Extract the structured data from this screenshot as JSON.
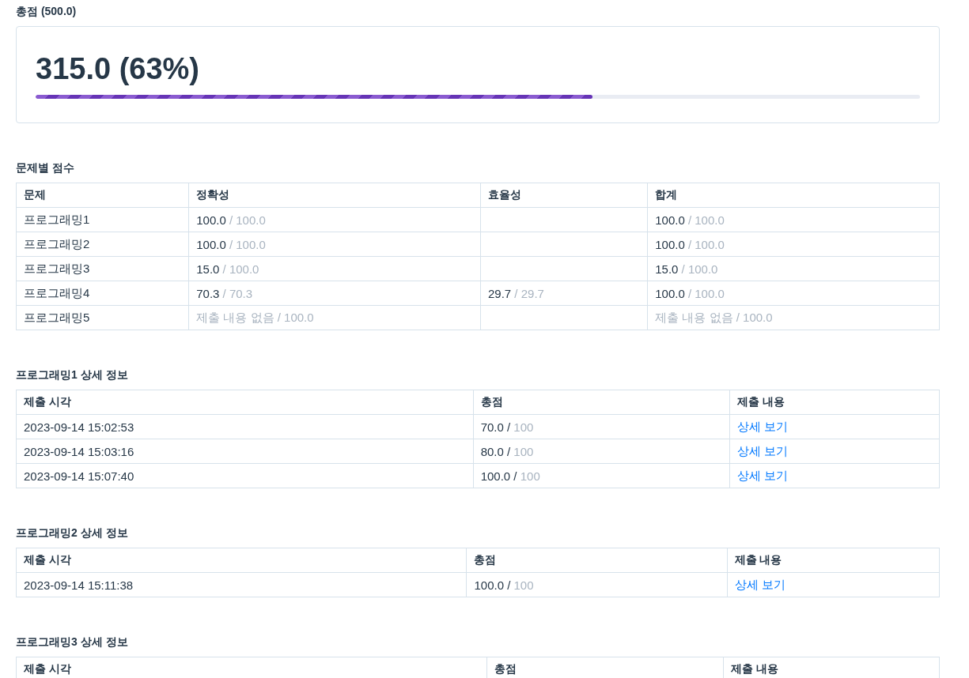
{
  "total": {
    "title": "총점 (500.0)",
    "score": "315.0 (63%)",
    "level": 0.63
  },
  "problem_scores": {
    "title": "문제별 점수",
    "columns": [
      "문제",
      "정확성",
      "효율성",
      "합계"
    ],
    "rows": [
      {
        "problem": "프로그래밍1",
        "accuracy": {
          "kind": "score",
          "value": "100.0",
          "max": "/ 100.0"
        },
        "efficiency": null,
        "total": {
          "kind": "score",
          "value": "100.0",
          "max": "/ 100.0"
        }
      },
      {
        "problem": "프로그래밍2",
        "accuracy": {
          "kind": "score",
          "value": "100.0",
          "max": "/ 100.0"
        },
        "efficiency": null,
        "total": {
          "kind": "score",
          "value": "100.0",
          "max": "/ 100.0"
        }
      },
      {
        "problem": "프로그래밍3",
        "accuracy": {
          "kind": "score",
          "value": "15.0",
          "max": "/ 100.0"
        },
        "efficiency": null,
        "total": {
          "kind": "score",
          "value": "15.0",
          "max": "/ 100.0"
        }
      },
      {
        "problem": "프로그래밍4",
        "accuracy": {
          "kind": "score",
          "value": "70.3",
          "max": "/ 70.3"
        },
        "efficiency": {
          "kind": "score",
          "value": "29.7",
          "max": "/ 29.7"
        },
        "total": {
          "kind": "score",
          "value": "100.0",
          "max": "/ 100.0"
        }
      },
      {
        "problem": "프로그래밍5",
        "accuracy": {
          "kind": "none",
          "text": "제출 내용 없음 / 100.0"
        },
        "efficiency": null,
        "total": {
          "kind": "none",
          "text": "제출 내용 없음 / 100.0"
        }
      }
    ]
  },
  "details": [
    {
      "title": "프로그래밍1 상세 정보",
      "columns": [
        "제출 시각",
        "총점",
        "제출 내용"
      ],
      "rows": [
        {
          "time": "2023-09-14 15:02:53",
          "value": "70.0 /",
          "max": "100",
          "link": "상세 보기"
        },
        {
          "time": "2023-09-14 15:03:16",
          "value": "80.0 /",
          "max": "100",
          "link": "상세 보기"
        },
        {
          "time": "2023-09-14 15:07:40",
          "value": "100.0 /",
          "max": "100",
          "link": "상세 보기"
        }
      ]
    },
    {
      "title": "프로그래밍2 상세 정보",
      "columns": [
        "제출 시각",
        "총점",
        "제출 내용"
      ],
      "rows": [
        {
          "time": "2023-09-14 15:11:38",
          "value": "100.0 /",
          "max": "100",
          "link": "상세 보기"
        }
      ]
    },
    {
      "title": "프로그래밍3 상세 정보",
      "columns": [
        "제출 시각",
        "총점",
        "제출 내용"
      ]
    }
  ]
}
